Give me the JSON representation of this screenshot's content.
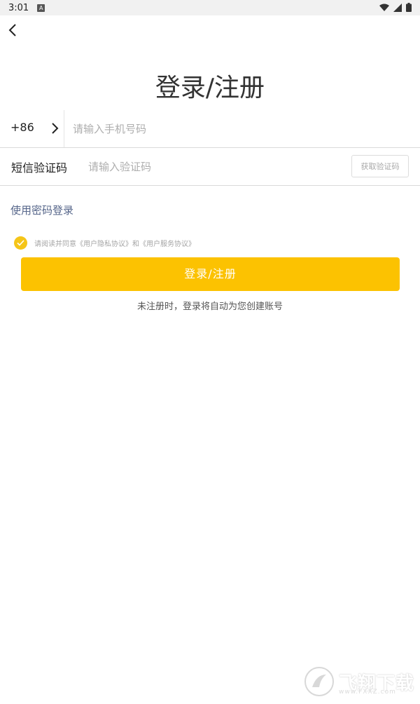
{
  "status_bar": {
    "time": "3:01",
    "notification_letter": "A"
  },
  "title": "登录/注册",
  "phone": {
    "country_code": "+86",
    "placeholder": "请输入手机号码",
    "value": ""
  },
  "code": {
    "label": "短信验证码",
    "placeholder": "请输入验证码",
    "value": "",
    "get_code_label": "获取验证码"
  },
  "password_login_label": "使用密码登录",
  "agreement": {
    "checked": true,
    "text": "请阅读并同意《用户隐私协议》和《用户服务协议》"
  },
  "submit_label": "登录/注册",
  "hint": "未注册时，登录将自动为您创建账号",
  "watermark": {
    "text": "飞翔下载",
    "sub": "www.FXXZ.com"
  },
  "colors": {
    "accent": "#fcc201",
    "link": "#56668a",
    "placeholder": "#aeaeae"
  }
}
